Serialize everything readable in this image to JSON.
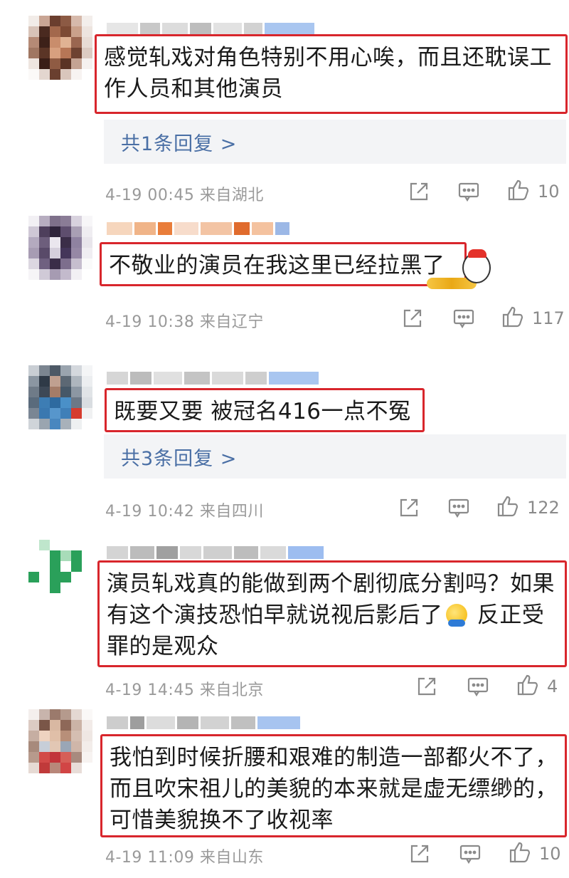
{
  "comments": [
    {
      "text": "感觉轧戏对角色特别不用心唉，而且还耽误工作人员和其他演员",
      "reply": "共1条回复 >",
      "meta": "4-19 00:45 来自湖北",
      "likes": "10"
    },
    {
      "text": "不敬业的演员在我这里已经拉黑了",
      "meta": "4-19 10:38 来自辽宁",
      "likes": "117"
    },
    {
      "text": "既要又要 被冠名416一点不冤",
      "reply": "共3条回复 >",
      "meta": "4-19 10:42 来自四川",
      "likes": "122"
    },
    {
      "text_before_emoji": "演员轧戏真的能做到两个剧彻底分割吗？如果有这个演技恐怕早就说视后影后了",
      "text_after_emoji": " 反正受罪的是观众",
      "meta": "4-19 14:45 来自北京",
      "likes": "4"
    },
    {
      "text": "我怕到时候折腰和艰难的制造一部都火不了，而且吹宋祖儿的美貌的本来就是虚无缥缈的，可惜美貌换不了收视率",
      "meta": "4-19 11:09 来自山东",
      "likes": "10"
    }
  ],
  "icons": {
    "share": "share-icon",
    "comment": "comment-icon",
    "like": "like-icon"
  },
  "colors": {
    "highlight_border": "#d8262c",
    "reply_link": "#4a6fa5",
    "meta_text": "#9a9a9a"
  }
}
